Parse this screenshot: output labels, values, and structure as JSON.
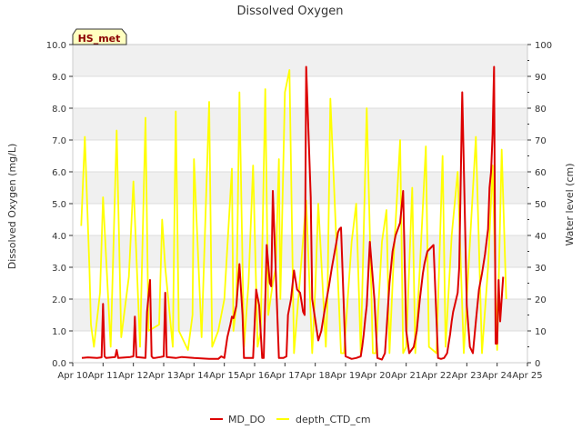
{
  "chart_data": {
    "type": "line",
    "title": "Dissolved Oxygen",
    "xlabel": "",
    "ylabel": "Dissolved Oxygen (mg/L)",
    "y2label": "Water level (cm)",
    "annotation": "HS_met",
    "x_ticks": [
      "Apr 10",
      "Apr 11",
      "Apr 12",
      "Apr 13",
      "Apr 14",
      "Apr 15",
      "Apr 16",
      "Apr 17",
      "Apr 18",
      "Apr 19",
      "Apr 20",
      "Apr 21",
      "Apr 22",
      "Apr 23",
      "Apr 24",
      "Apr 25"
    ],
    "xlim": [
      10,
      25
    ],
    "ylim": [
      0,
      10
    ],
    "y_ticks": [
      "0.0",
      "1.0",
      "2.0",
      "3.0",
      "4.0",
      "5.0",
      "6.0",
      "7.0",
      "8.0",
      "9.0",
      "10.0"
    ],
    "y2lim": [
      0,
      100
    ],
    "y2_ticks": [
      "0",
      "10",
      "20",
      "30",
      "40",
      "50",
      "60",
      "70",
      "80",
      "90",
      "100"
    ],
    "grid": "horizontal bands",
    "legend_position": "bottom",
    "colors": {
      "MD_DO": "#dd0000",
      "depth_CTD_cm": "#ffff00",
      "band": "#f0f0f0",
      "annotation_bg": "#ffffc0",
      "annotation_text": "#8b0000"
    },
    "series": [
      {
        "name": "MD_DO",
        "axis": "left",
        "x": [
          10.3,
          10.5,
          10.8,
          10.95,
          11.0,
          11.05,
          11.1,
          11.4,
          11.45,
          11.5,
          11.9,
          12.0,
          12.05,
          12.1,
          12.4,
          12.45,
          12.55,
          12.6,
          12.65,
          12.7,
          12.9,
          13.0,
          13.05,
          13.1,
          13.4,
          13.6,
          14.0,
          14.5,
          14.8,
          14.9,
          15.0,
          15.1,
          15.2,
          15.25,
          15.3,
          15.4,
          15.5,
          15.6,
          15.65,
          15.7,
          15.8,
          15.95,
          16.05,
          16.15,
          16.25,
          16.3,
          16.4,
          16.5,
          16.55,
          16.6,
          16.8,
          16.95,
          17.05,
          17.1,
          17.2,
          17.3,
          17.4,
          17.5,
          17.55,
          17.6,
          17.65,
          17.7,
          17.85,
          17.9,
          18.1,
          18.2,
          18.3,
          18.45,
          18.55,
          18.7,
          18.75,
          18.8,
          18.85,
          19.0,
          19.2,
          19.35,
          19.5,
          19.55,
          19.6,
          19.65,
          19.7,
          19.8,
          19.95,
          20.05,
          20.2,
          20.3,
          20.35,
          20.45,
          20.55,
          20.65,
          20.8,
          20.9,
          21.0,
          21.1,
          21.25,
          21.35,
          21.45,
          21.55,
          21.6,
          21.65,
          21.7,
          21.9,
          22.05,
          22.15,
          22.25,
          22.35,
          22.45,
          22.5,
          22.55,
          22.6,
          22.7,
          22.75,
          22.85,
          23.0,
          23.1,
          23.2,
          23.3,
          23.4,
          23.5,
          23.6,
          23.7,
          23.75,
          23.8,
          23.85,
          23.9,
          23.95,
          24.0,
          24.05,
          24.1,
          24.2
        ],
        "values": [
          0.15,
          0.17,
          0.15,
          0.17,
          1.85,
          0.2,
          0.15,
          0.18,
          0.4,
          0.15,
          0.18,
          0.2,
          1.45,
          0.18,
          0.15,
          1.6,
          2.6,
          0.2,
          0.15,
          0.15,
          0.18,
          0.2,
          2.2,
          0.18,
          0.15,
          0.18,
          0.15,
          0.12,
          0.12,
          0.2,
          0.15,
          0.8,
          1.2,
          1.45,
          1.4,
          1.8,
          3.1,
          1.5,
          0.15,
          0.15,
          0.15,
          0.15,
          2.3,
          1.8,
          0.15,
          0.15,
          3.7,
          2.5,
          2.4,
          5.4,
          0.15,
          0.15,
          0.2,
          1.5,
          2.0,
          2.9,
          2.3,
          2.2,
          1.9,
          1.6,
          1.5,
          9.3,
          5.2,
          2.0,
          0.7,
          1.0,
          1.6,
          2.4,
          3.0,
          3.8,
          4.1,
          4.2,
          4.25,
          0.2,
          0.12,
          0.15,
          0.2,
          0.5,
          0.9,
          1.4,
          1.8,
          3.8,
          2.0,
          0.15,
          0.1,
          0.3,
          1.0,
          2.5,
          3.5,
          4.0,
          4.4,
          5.4,
          1.0,
          0.3,
          0.5,
          1.0,
          2.0,
          2.8,
          3.1,
          3.3,
          3.5,
          3.7,
          0.15,
          0.12,
          0.15,
          0.3,
          0.9,
          1.3,
          1.6,
          1.8,
          2.2,
          3.0,
          8.5,
          1.8,
          0.5,
          0.3,
          1.3,
          2.3,
          2.8,
          3.4,
          4.2,
          5.5,
          6.0,
          7.2,
          9.3,
          0.6,
          0.6,
          2.6,
          1.3,
          2.7
        ]
      },
      {
        "name": "depth_CTD_cm",
        "axis": "right",
        "x": [
          10.28,
          10.4,
          10.55,
          10.6,
          10.7,
          10.9,
          11.0,
          11.25,
          11.45,
          11.6,
          11.85,
          12.0,
          12.22,
          12.4,
          12.5,
          12.85,
          12.95,
          13.05,
          13.3,
          13.4,
          13.5,
          13.8,
          13.95,
          14.0,
          14.25,
          14.5,
          14.6,
          14.8,
          15.0,
          15.25,
          15.3,
          15.4,
          15.5,
          15.65,
          15.8,
          15.95,
          16.1,
          16.2,
          16.35,
          16.45,
          16.6,
          16.7,
          16.8,
          16.85,
          17.0,
          17.15,
          17.3,
          17.4,
          17.7,
          17.9,
          18.0,
          18.1,
          18.35,
          18.4,
          18.5,
          18.85,
          18.95,
          19.2,
          19.35,
          19.5,
          19.7,
          19.9,
          20.0,
          20.2,
          20.35,
          20.45,
          20.6,
          20.8,
          20.9,
          21.0,
          21.2,
          21.3,
          21.45,
          21.65,
          21.75,
          22.0,
          22.2,
          22.3,
          22.5,
          22.7,
          22.9,
          23.0,
          23.3,
          23.5,
          23.7,
          23.85,
          24.0,
          24.15,
          24.3
        ],
        "values": [
          43,
          71,
          30,
          12,
          5,
          22,
          52,
          5,
          73,
          8,
          27,
          57,
          5,
          77,
          10,
          12,
          45,
          30,
          5,
          79,
          10,
          4,
          15,
          64,
          8,
          82,
          5,
          10,
          20,
          61,
          10,
          18,
          85,
          5,
          25,
          62,
          5,
          10,
          86,
          15,
          25,
          30,
          64,
          20,
          85,
          92,
          3,
          15,
          51,
          3,
          23,
          50,
          5,
          18,
          83,
          3,
          3,
          38,
          50,
          3,
          80,
          3,
          3,
          38,
          48,
          3,
          35,
          70,
          3,
          5,
          55,
          3,
          30,
          68,
          5,
          3,
          65,
          5,
          40,
          60,
          3,
          20,
          71,
          3,
          30,
          62,
          4,
          67,
          20
        ]
      }
    ]
  }
}
